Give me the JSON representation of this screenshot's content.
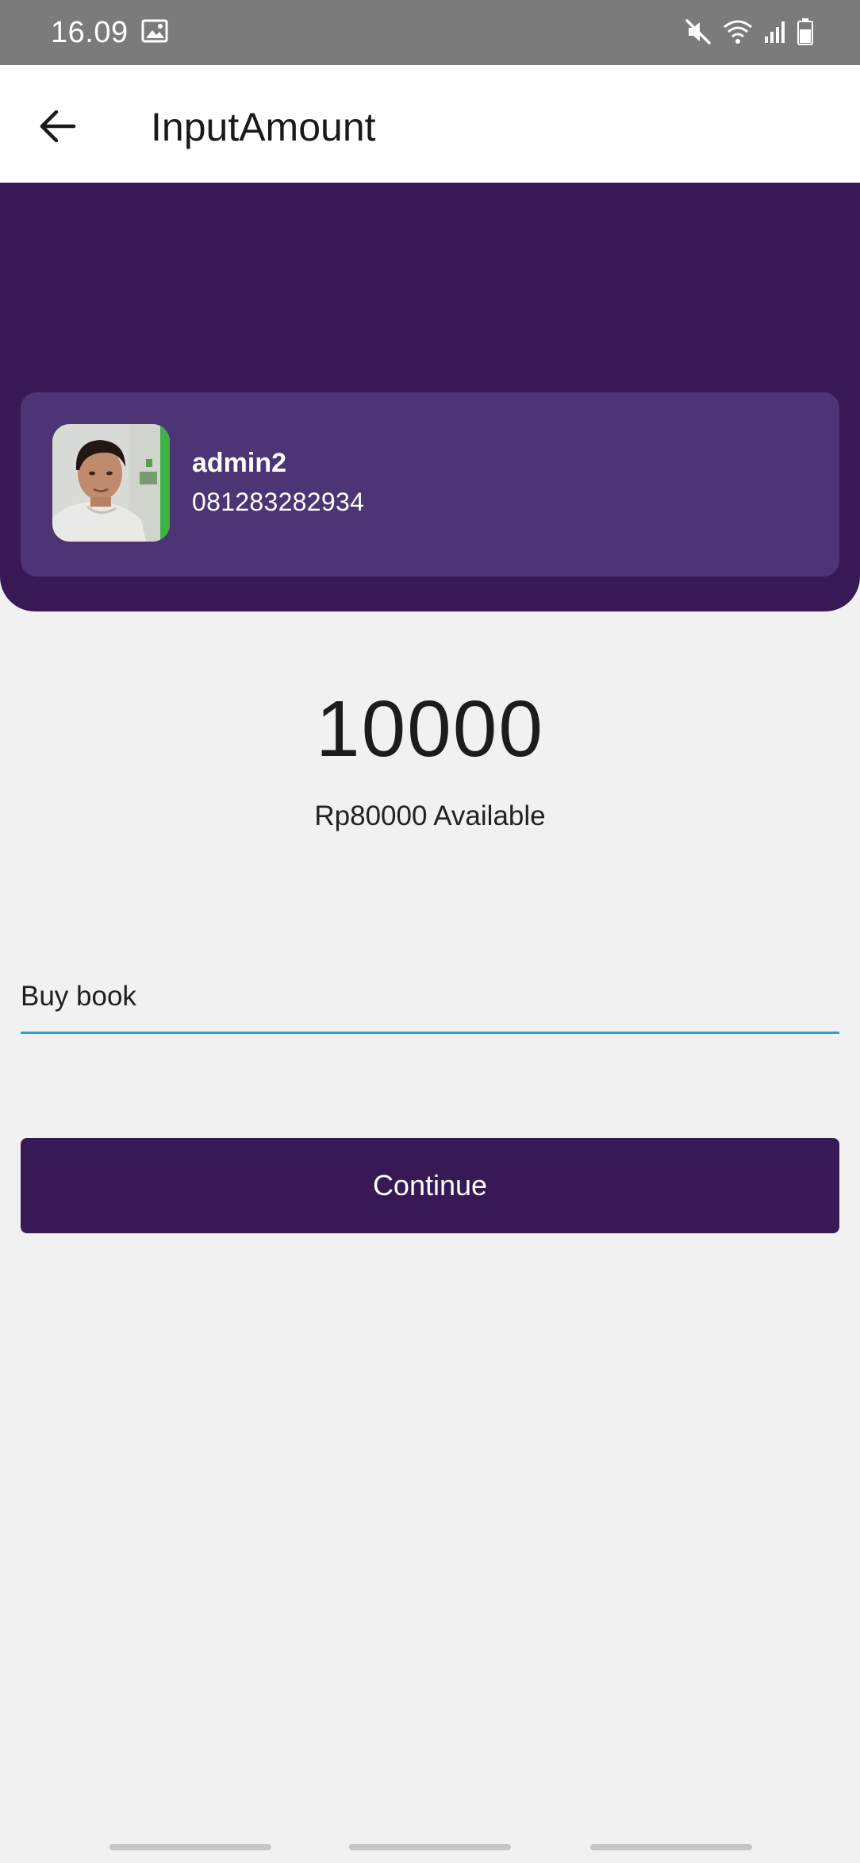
{
  "status_bar": {
    "time": "16.09",
    "icons": [
      "gallery-icon",
      "mute-icon",
      "wifi-icon",
      "signal-icon",
      "battery-icon"
    ]
  },
  "app_bar": {
    "title": "InputAmount",
    "back_icon": "arrow-left-icon"
  },
  "recipient": {
    "name": "admin2",
    "phone": "081283282934"
  },
  "amount": {
    "value": "10000",
    "available": "Rp80000 Available"
  },
  "note": {
    "value": "Buy book"
  },
  "actions": {
    "continue_label": "Continue"
  },
  "colors": {
    "primary": "#371a55",
    "card": "#4d3474",
    "accent_underline": "#2ba3c9",
    "background": "#f1f1f1"
  }
}
